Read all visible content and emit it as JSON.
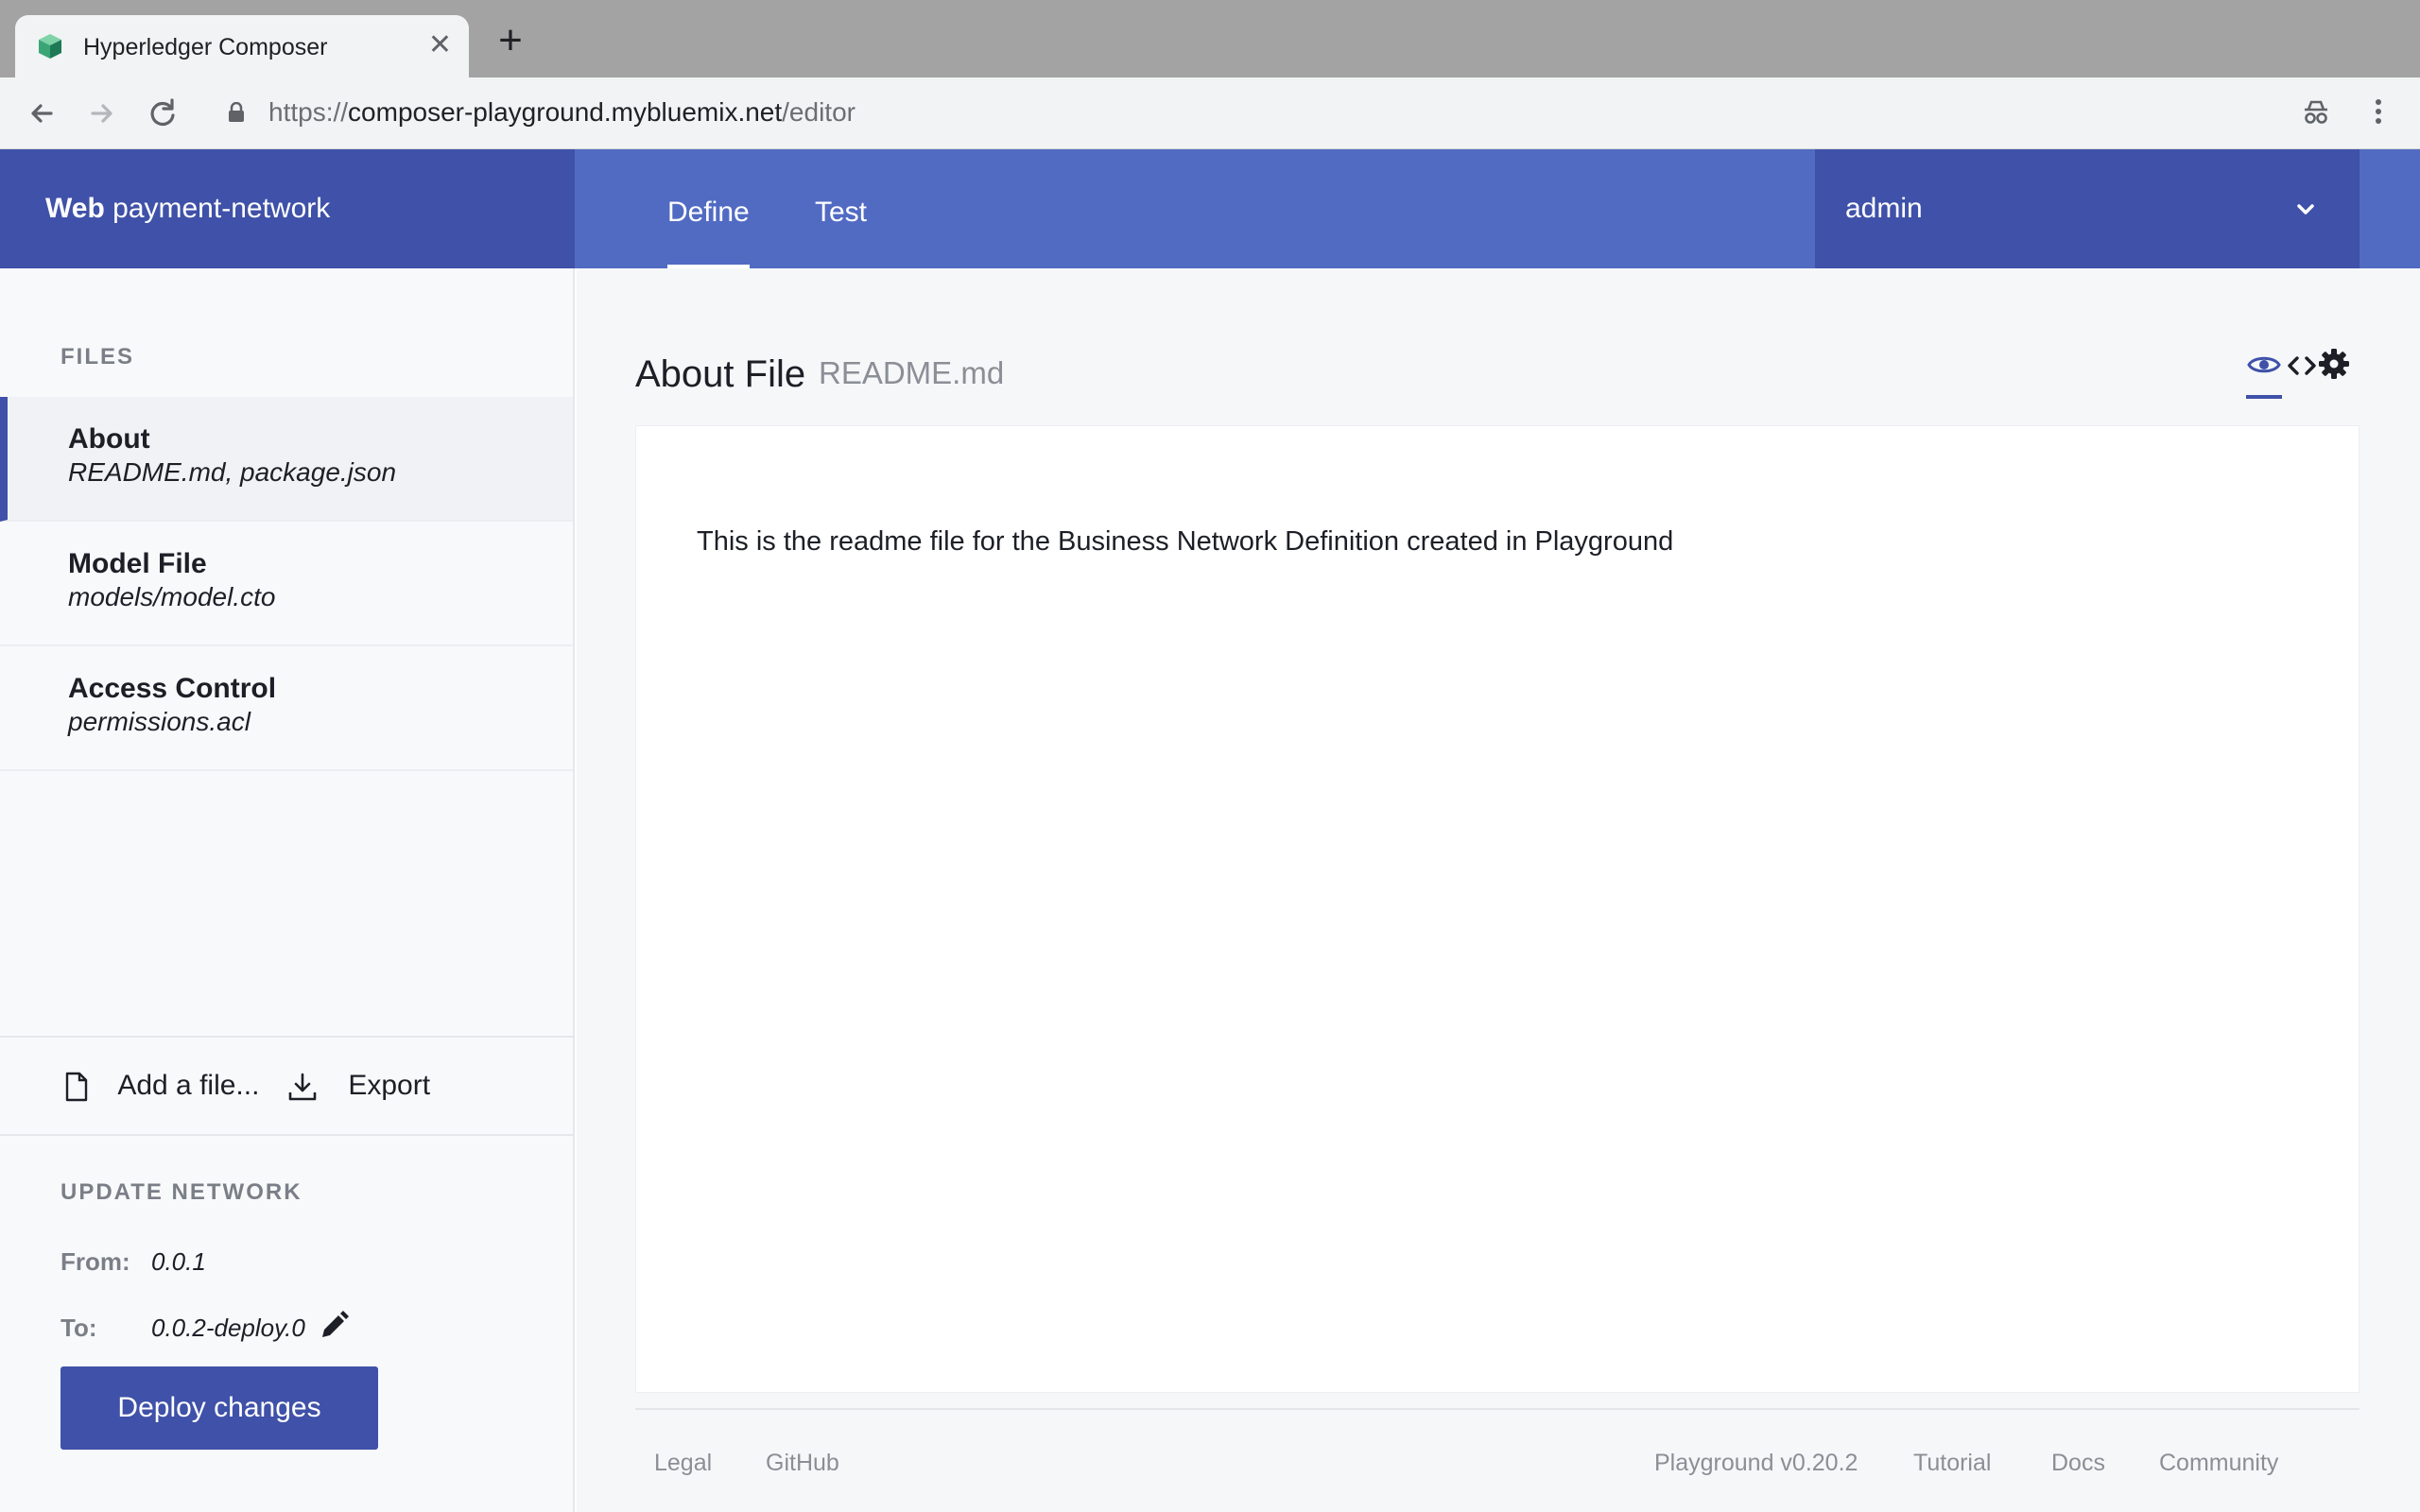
{
  "browser": {
    "tab_title": "Hyperledger Composer",
    "tab_close": "✕",
    "new_tab": "+",
    "url_scheme": "https://",
    "url_host": "composer-playground.mybluemix.net",
    "url_path": "/editor"
  },
  "header": {
    "brand_bold": "Web",
    "brand_rest": "payment-network",
    "tabs": [
      {
        "label": "Define",
        "active": true
      },
      {
        "label": "Test",
        "active": false
      }
    ],
    "identity": "admin"
  },
  "sidebar": {
    "files_heading": "FILES",
    "files": [
      {
        "title": "About",
        "subtitle": "README.md, package.json",
        "active": true
      },
      {
        "title": "Model File",
        "subtitle": "models/model.cto",
        "active": false
      },
      {
        "title": "Access Control",
        "subtitle": "permissions.acl",
        "active": false
      }
    ],
    "add_file_label": "Add a file...",
    "export_label": "Export",
    "update_heading": "UPDATE NETWORK",
    "from_label": "From:",
    "from_value": "0.0.1",
    "to_label": "To:",
    "to_value": "0.0.2-deploy.0",
    "deploy_label": "Deploy changes"
  },
  "main": {
    "title": "About File",
    "file_name": "README.md",
    "readme_text": "This is the readme file for the Business Network Definition created in Playground"
  },
  "footer": {
    "legal": "Legal",
    "github": "GitHub",
    "version": "Playground v0.20.2",
    "tutorial": "Tutorial",
    "docs": "Docs",
    "community": "Community"
  },
  "colors": {
    "brand_dark": "#3f51a8",
    "brand": "#516bc3"
  }
}
